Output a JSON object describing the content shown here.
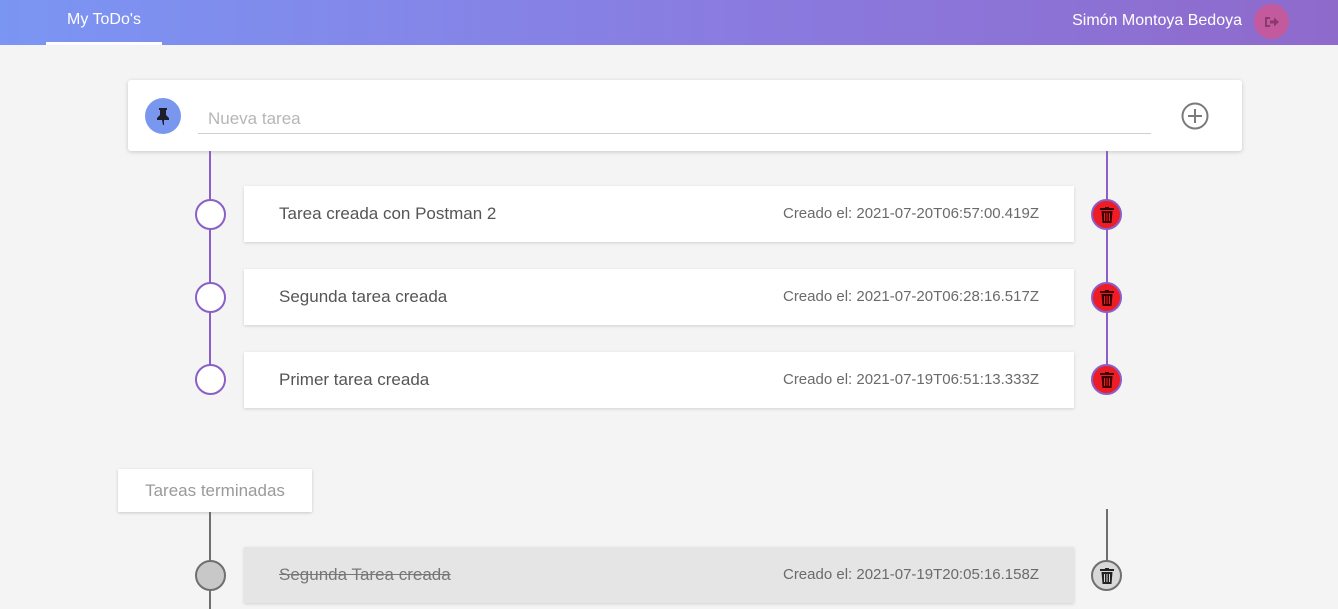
{
  "navbar": {
    "brand_tab": "My ToDo's",
    "user_name": "Simón Montoya Bedoya",
    "logout_icon": "sign-out-icon"
  },
  "new_task": {
    "placeholder": "Nueva tarea",
    "value": "",
    "pin_icon": "thumbtack-icon",
    "add_icon": "plus-circle-icon"
  },
  "pending_tasks": [
    {
      "title": "Tarea creada con Postman 2",
      "date": "Creado el: 2021-07-20T06:57:00.419Z"
    },
    {
      "title": "Segunda tarea creada",
      "date": "Creado el: 2021-07-20T06:28:16.517Z"
    },
    {
      "title": "Primer tarea creada",
      "date": "Creado el: 2021-07-19T06:51:13.333Z"
    }
  ],
  "completed_section": {
    "label": "Tareas terminadas",
    "tasks": [
      {
        "title": "Segunda Tarea creada",
        "date": "Creado el: 2021-07-19T20:05:16.158Z"
      }
    ]
  },
  "colors": {
    "nav_gradient_start": "#7b95f3",
    "nav_gradient_end": "#8e6acb",
    "timeline_purple": "#8a5fc8",
    "delete_red": "#ee1c24",
    "logout_pink": "#c45a9e"
  }
}
